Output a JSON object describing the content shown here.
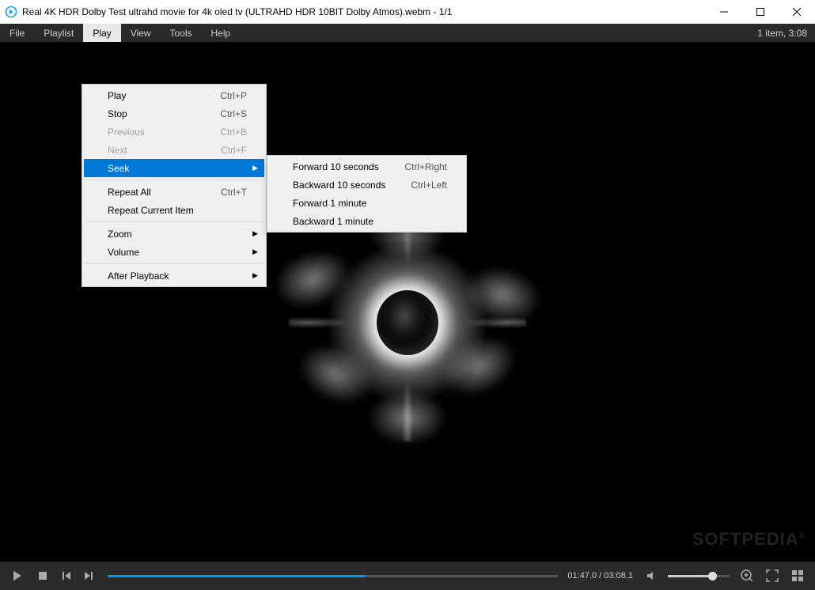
{
  "titlebar": {
    "title": "Real 4K HDR Dolby Test ultrahd movie for 4k oled tv (ULTRAHD HDR 10BIT Dolby Atmos).webm - 1/1"
  },
  "menubar": {
    "items": [
      "File",
      "Playlist",
      "Play",
      "View",
      "Tools",
      "Help"
    ],
    "status": "1 item, 3:08"
  },
  "play_menu": {
    "items": [
      {
        "label": "Play",
        "shortcut": "Ctrl+P"
      },
      {
        "label": "Stop",
        "shortcut": "Ctrl+S"
      },
      {
        "label": "Previous",
        "shortcut": "Ctrl+B",
        "disabled": true
      },
      {
        "label": "Next",
        "shortcut": "Ctrl+F",
        "disabled": true
      },
      {
        "label": "Seek",
        "submenu": true,
        "highlight": true
      },
      {
        "sep": true
      },
      {
        "label": "Repeat All",
        "shortcut": "Ctrl+T"
      },
      {
        "label": "Repeat Current Item"
      },
      {
        "sep": true
      },
      {
        "label": "Zoom",
        "submenu": true
      },
      {
        "label": "Volume",
        "submenu": true
      },
      {
        "sep": true
      },
      {
        "label": "After Playback",
        "submenu": true
      }
    ]
  },
  "seek_menu": {
    "items": [
      {
        "label": "Forward 10 seconds",
        "shortcut": "Ctrl+Right"
      },
      {
        "label": "Backward 10 seconds",
        "shortcut": "Ctrl+Left"
      },
      {
        "label": "Forward 1 minute"
      },
      {
        "label": "Backward 1 minute"
      }
    ]
  },
  "playback": {
    "time_display": "01:47.0 / 03:08.1",
    "progress_percent": 57,
    "volume_percent": 72
  },
  "watermark": "SOFTPEDIA"
}
